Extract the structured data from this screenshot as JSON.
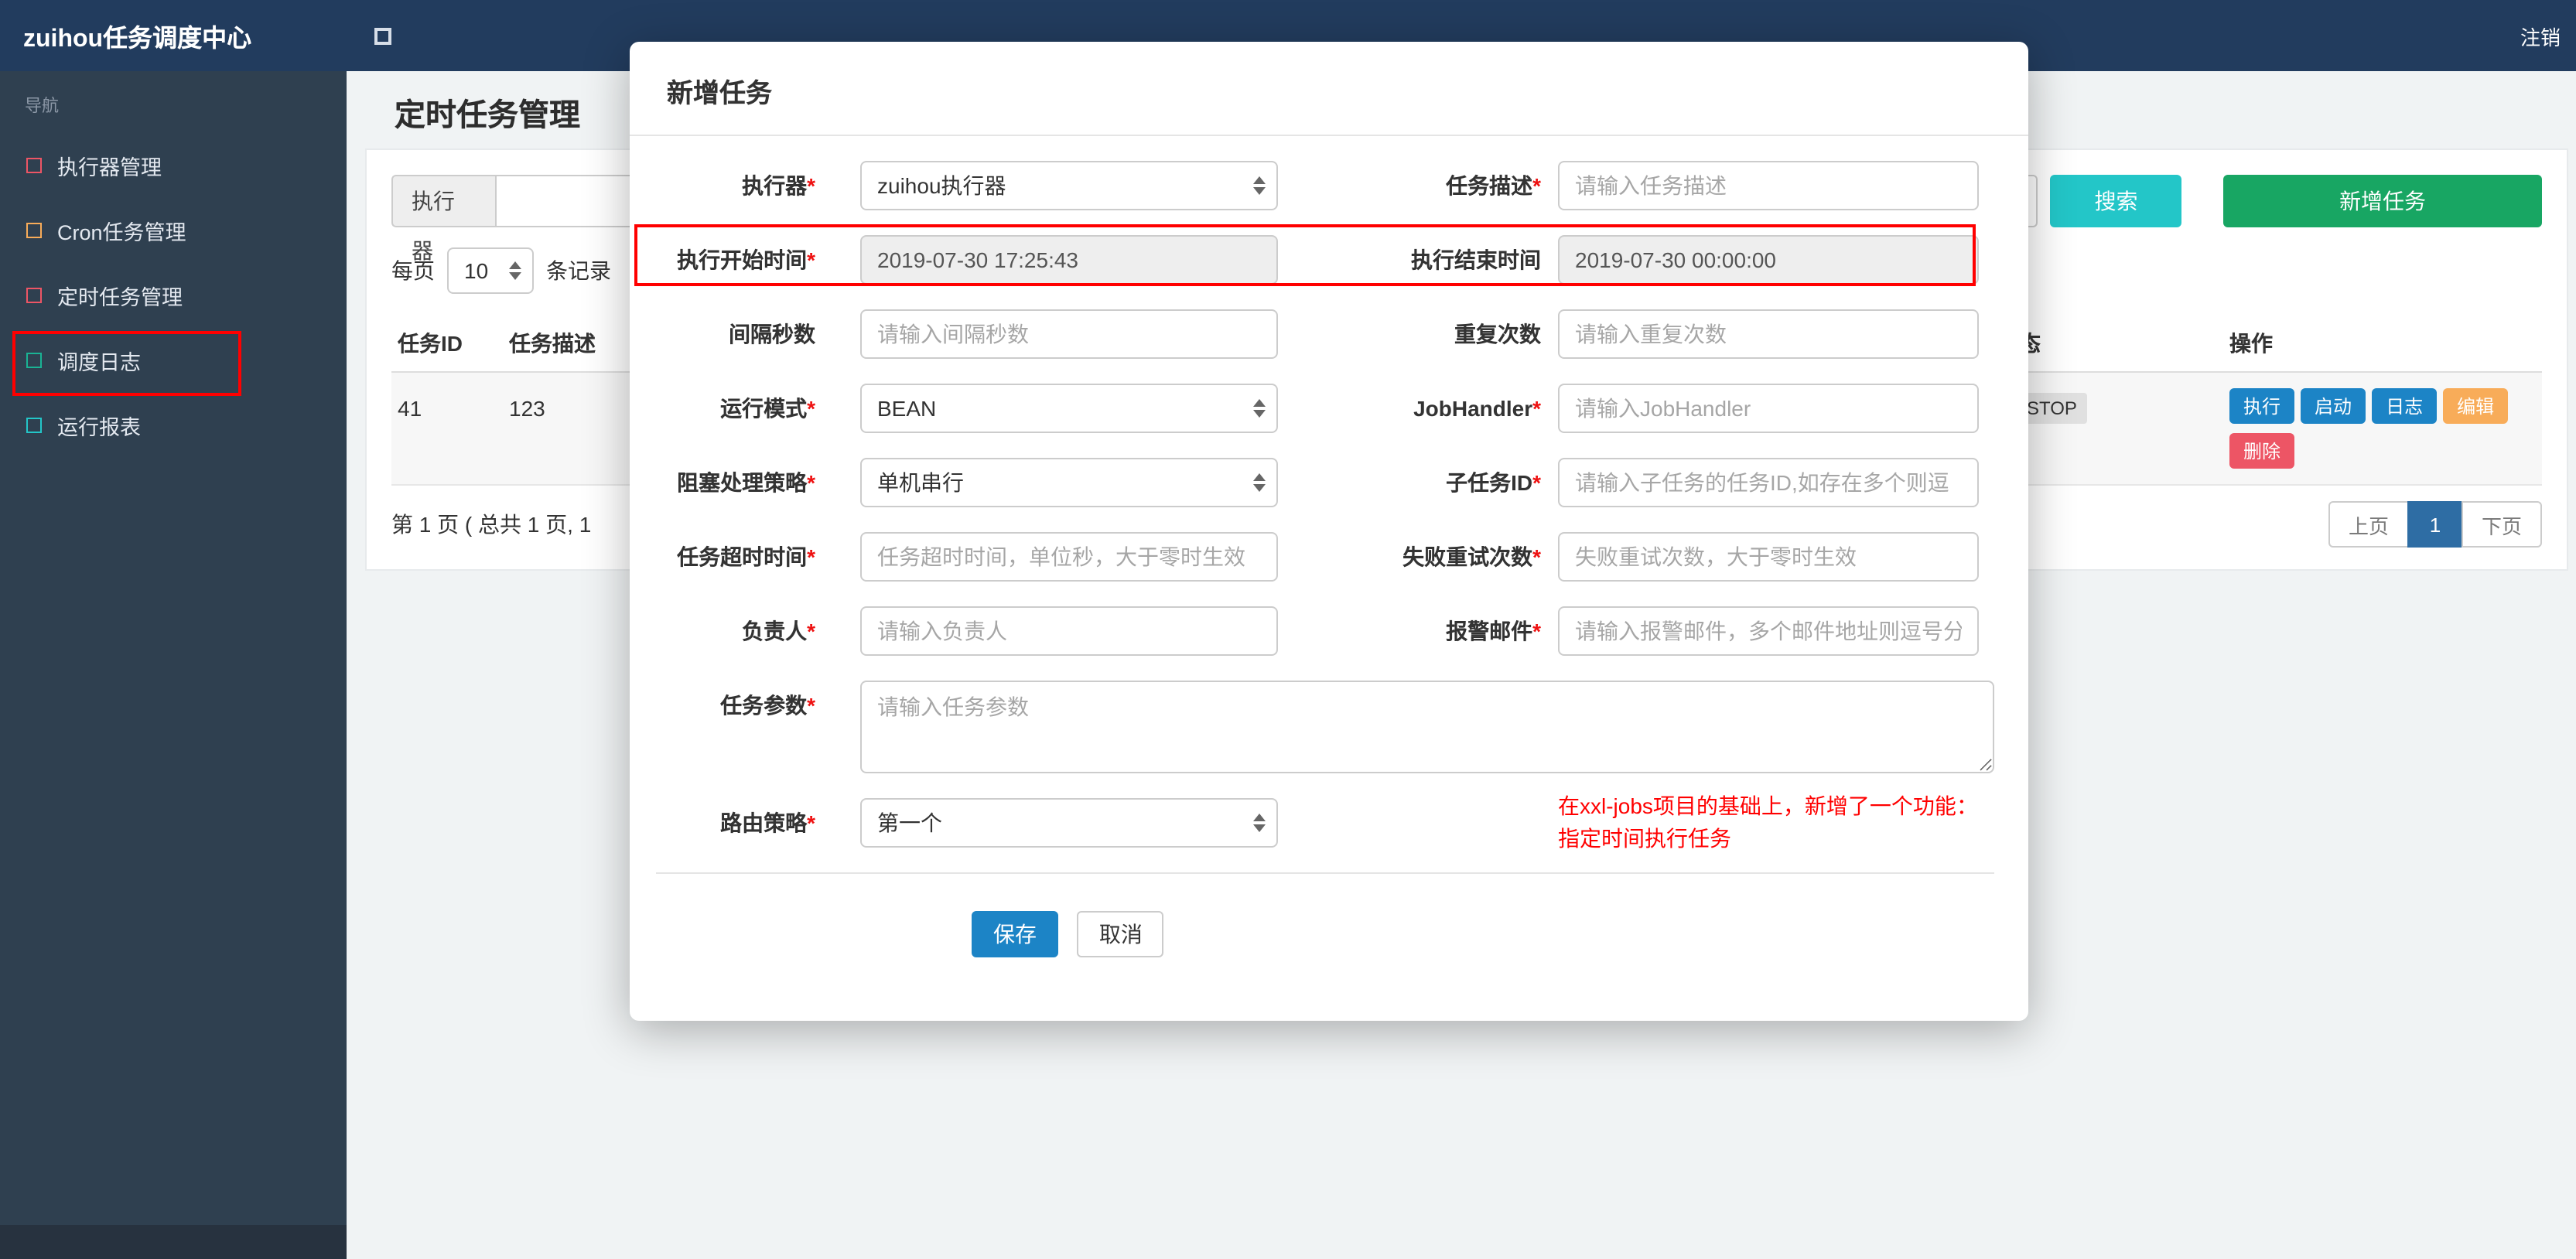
{
  "colors": {
    "topbar": "#223c5e",
    "sidebar": "#2f4050",
    "search_button": "#23c6c8",
    "add_button": "#18a663",
    "primary_blue": "#1c84c6",
    "warning_orange": "#f8ac59",
    "danger_red": "#ed5565",
    "active_page": "#2e6da4",
    "annotation": "#ff0000"
  },
  "navbar": {
    "brand": "zuihou任务调度中心",
    "logout": "注销"
  },
  "sidebar": {
    "nav_label": "导航",
    "items": [
      {
        "label": "执行器管理",
        "icon": "square-red-icon"
      },
      {
        "label": "Cron任务管理",
        "icon": "square-orange-icon"
      },
      {
        "label": "定时任务管理",
        "icon": "square-red-icon"
      },
      {
        "label": "调度日志",
        "icon": "square-green-icon"
      },
      {
        "label": "运行报表",
        "icon": "square-teal-icon"
      }
    ]
  },
  "page": {
    "title": "定时任务管理",
    "filter": {
      "executor_label": "执行器",
      "search_button": "搜索",
      "add_button": "新增任务"
    },
    "per_page": {
      "prefix": "每页",
      "value": "10",
      "suffix": "条记录"
    },
    "table": {
      "headers": [
        "任务ID",
        "任务描述",
        "状态",
        "操作"
      ],
      "row": {
        "id": "41",
        "desc": "123",
        "status": "STOP",
        "actions": [
          {
            "label": "执行"
          },
          {
            "label": "启动"
          },
          {
            "label": "日志"
          },
          {
            "label": "编辑"
          },
          {
            "label": "删除"
          }
        ]
      }
    },
    "pagination": {
      "info": "第 1 页 ( 总共 1 页, 1",
      "prev": "上页",
      "current": "1",
      "next": "下页"
    }
  },
  "modal": {
    "title": "新增任务",
    "fields": {
      "executor": {
        "label": "执行器",
        "star": "*",
        "value": "zuihou执行器"
      },
      "desc": {
        "label": "任务描述",
        "star": "*",
        "placeholder": "请输入任务描述"
      },
      "start": {
        "label": "执行开始时间",
        "star": "*",
        "value": "2019-07-30 17:25:43"
      },
      "end": {
        "label": "执行结束时间",
        "star": "",
        "value": "2019-07-30 00:00:00"
      },
      "interval": {
        "label": "间隔秒数",
        "star": "",
        "placeholder": "请输入间隔秒数"
      },
      "repeat": {
        "label": "重复次数",
        "star": "",
        "placeholder": "请输入重复次数"
      },
      "mode": {
        "label": "运行模式",
        "star": "*",
        "value": "BEAN"
      },
      "handler": {
        "label": "JobHandler",
        "star": "*",
        "placeholder": "请输入JobHandler"
      },
      "block": {
        "label": "阻塞处理策略",
        "star": "*",
        "value": "单机串行"
      },
      "child": {
        "label": "子任务ID",
        "star": "*",
        "placeholder": "请输入子任务的任务ID,如存在多个则逗"
      },
      "timeout": {
        "label": "任务超时时间",
        "star": "*",
        "placeholder": "任务超时时间，单位秒，大于零时生效"
      },
      "retry": {
        "label": "失败重试次数",
        "star": "*",
        "placeholder": "失败重试次数，大于零时生效"
      },
      "owner": {
        "label": "负责人",
        "star": "*",
        "placeholder": "请输入负责人"
      },
      "email": {
        "label": "报警邮件",
        "star": "*",
        "placeholder": "请输入报警邮件，多个邮件地址则逗号分"
      },
      "params": {
        "label": "任务参数",
        "star": "*",
        "placeholder": "请输入任务参数"
      },
      "route": {
        "label": "路由策略",
        "star": "*",
        "value": "第一个"
      }
    },
    "note_line1": "在xxl-jobs项目的基础上，新增了一个功能：",
    "note_line2": "指定时间执行任务",
    "save": "保存",
    "cancel": "取消"
  }
}
